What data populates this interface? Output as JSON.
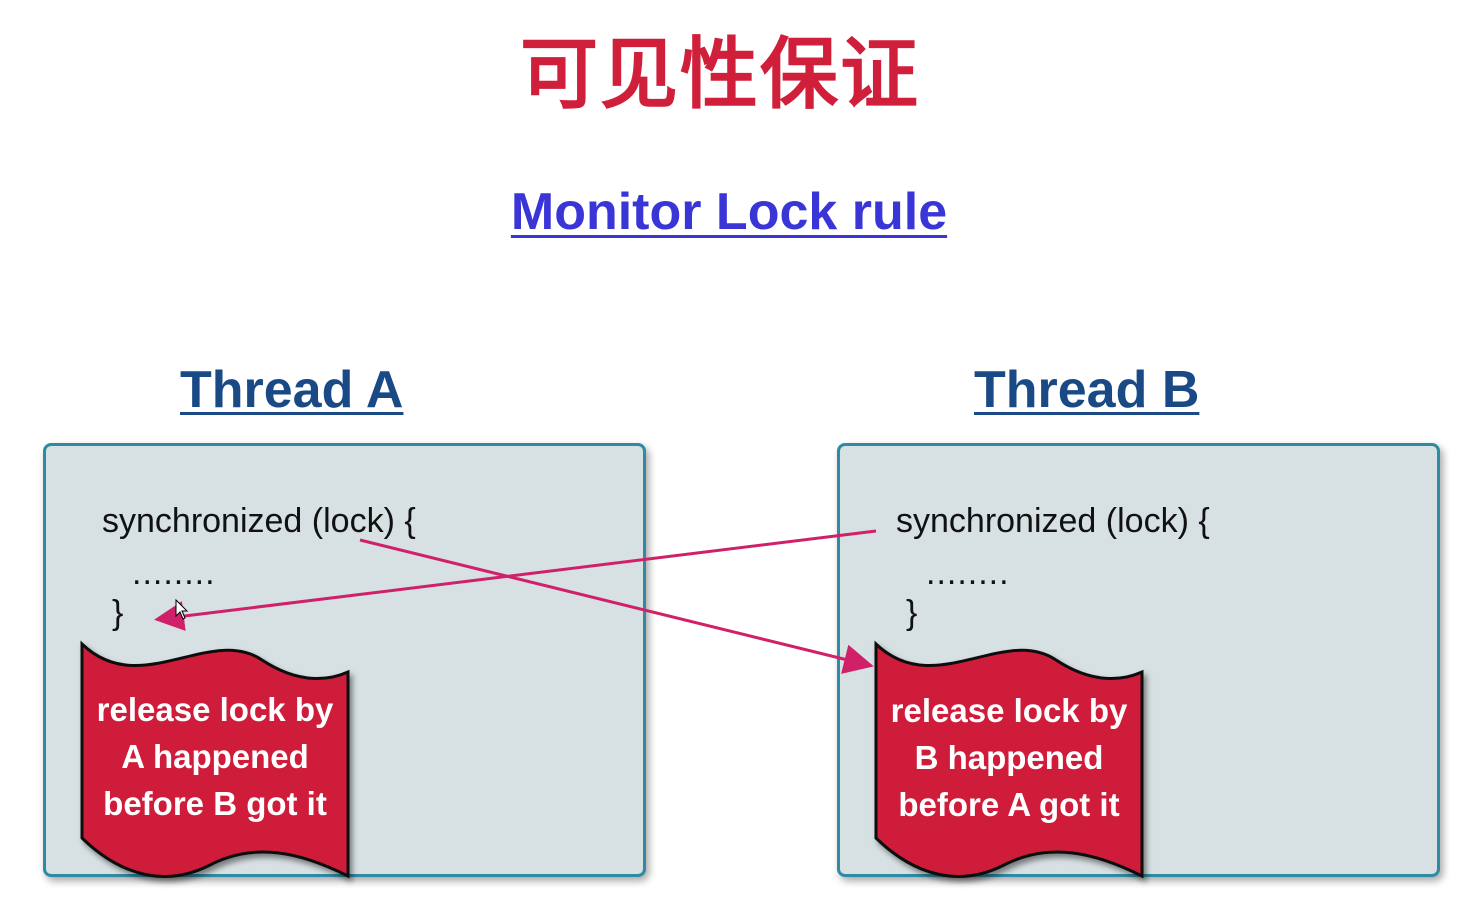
{
  "title": "可见性保证",
  "subtitle": "Monitor Lock rule",
  "threads": [
    {
      "label": "Thread A",
      "code": {
        "line1": "synchronized (lock) {",
        "dots": "........",
        "close": "}"
      },
      "flag": {
        "line1": "release lock by",
        "line2": "A happened",
        "line3": "before B got it"
      }
    },
    {
      "label": "Thread B",
      "code": {
        "line1": "synchronized (lock) {",
        "dots": "........",
        "close": "}"
      },
      "flag": {
        "line1": "release lock by",
        "line2": "B happened",
        "line3": "before A got it"
      }
    }
  ],
  "colors": {
    "title": "#d01f3b",
    "subtitle": "#3a35d6",
    "thread_label": "#1a4a86",
    "box_fill": "#d7e0e3",
    "box_border": "#2f8aa3",
    "flag_fill": "#d01f3b",
    "arrow": "#d0206a"
  }
}
